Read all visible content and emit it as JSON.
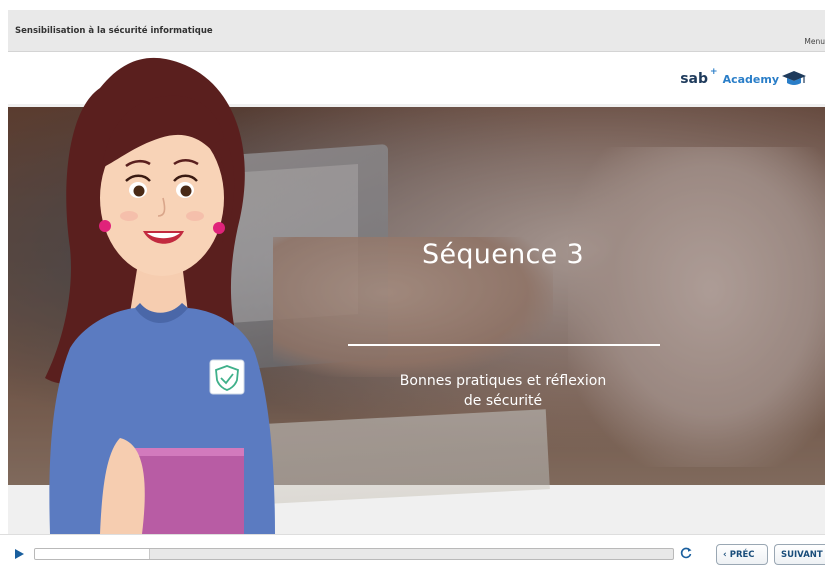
{
  "header": {
    "course_title": "Sensibilisation à la sécurité informatique",
    "menu_label": "Menu"
  },
  "brand": {
    "sab": "sab",
    "plus": "+",
    "academy": "Academy",
    "icon": "graduation-cap-icon"
  },
  "slide": {
    "title": "Séquence 3",
    "subtitle_line1": "Bonnes pratiques et réflexion",
    "subtitle_line2": "de sécurité"
  },
  "controls": {
    "play_icon": "play-icon",
    "progress": 0.18,
    "replay_icon": "replay-icon",
    "prev_label": "PRÉC",
    "next_label": "SUIVANT"
  },
  "colors": {
    "accent": "#1a5f9e",
    "brand_dark": "#1f3b5c",
    "brand_blue": "#2a7ec8",
    "top_bar": "#e9e9e9"
  }
}
